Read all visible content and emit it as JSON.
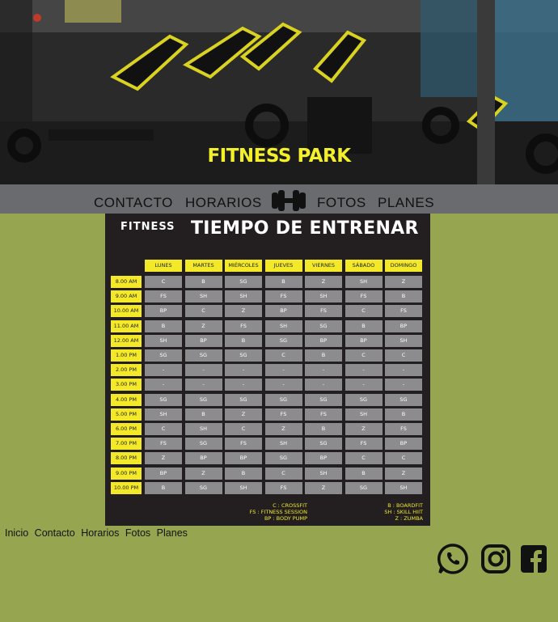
{
  "hero": {
    "title": "FITNESS PARK"
  },
  "nav": {
    "items": [
      "CONTACTO",
      "HORARIOS",
      "FOTOS",
      "PLANES"
    ]
  },
  "schedule": {
    "brand": "FITNESS",
    "title": "TIEMPO DE ENTRENAR",
    "days": [
      "LUNES",
      "MARTES",
      "MIÉRCOLES",
      "JUEVES",
      "VIERNES",
      "SÁBADO",
      "DOMINGO"
    ],
    "rows": [
      {
        "time": "8.00 AM",
        "classes": [
          "C",
          "B",
          "SG",
          "B",
          "Z",
          "SH",
          "Z"
        ]
      },
      {
        "time": "9.00 AM",
        "classes": [
          "FS",
          "SH",
          "SH",
          "FS",
          "SH",
          "FS",
          "B"
        ]
      },
      {
        "time": "10.00 AM",
        "classes": [
          "BP",
          "C",
          "Z",
          "BP",
          "FS",
          "C",
          "FS"
        ]
      },
      {
        "time": "11.00 AM",
        "classes": [
          "B",
          "Z",
          "FS",
          "SH",
          "SG",
          "B",
          "BP"
        ]
      },
      {
        "time": "12.00 AM",
        "classes": [
          "SH",
          "BP",
          "B",
          "SG",
          "BP",
          "BP",
          "SH"
        ]
      },
      {
        "time": "1.00 PM",
        "classes": [
          "SG",
          "SG",
          "SG",
          "C",
          "B",
          "C",
          "C"
        ]
      },
      {
        "time": "2.00 PM",
        "classes": [
          "-",
          "-",
          "-",
          "-",
          "-",
          "-",
          "-"
        ]
      },
      {
        "time": "3.00 PM",
        "classes": [
          "-",
          "-",
          "-",
          "-",
          "-",
          "-",
          "-"
        ]
      },
      {
        "time": "4.00 PM",
        "classes": [
          "SG",
          "SG",
          "SG",
          "SG",
          "SG",
          "SG",
          "SG"
        ]
      },
      {
        "time": "5.00 PM",
        "classes": [
          "SH",
          "B",
          "Z",
          "FS",
          "FS",
          "SH",
          "B"
        ]
      },
      {
        "time": "6.00 PM",
        "classes": [
          "C",
          "SH",
          "C",
          "Z",
          "B",
          "Z",
          "FS"
        ]
      },
      {
        "time": "7.00 PM",
        "classes": [
          "FS",
          "SG",
          "FS",
          "SH",
          "SG",
          "FS",
          "BP"
        ]
      },
      {
        "time": "8.00 PM",
        "classes": [
          "Z",
          "BP",
          "BP",
          "SG",
          "BP",
          "C",
          "C"
        ]
      },
      {
        "time": "9.00 PM",
        "classes": [
          "BP",
          "Z",
          "B",
          "C",
          "SH",
          "B",
          "Z"
        ]
      },
      {
        "time": "10.00 PM",
        "classes": [
          "B",
          "SG",
          "SH",
          "FS",
          "Z",
          "SG",
          "SH"
        ]
      }
    ],
    "legend_left": [
      "C : CROSSFIT",
      "FS : FITNESS SESSION",
      "BP : BODY PUMP"
    ],
    "legend_right": [
      "B : BOARDFIT",
      "SH : SKILL HIIT",
      "Z : ZUMBA"
    ]
  },
  "footer": {
    "links": [
      "Inicio",
      "Contacto",
      "Horarios",
      "Fotos",
      "Planes"
    ],
    "social": [
      "whatsapp-icon",
      "instagram-icon",
      "facebook-icon"
    ]
  },
  "colors": {
    "page_bg": "#96a650",
    "nav_bg": "#6a6b6e",
    "accent_yellow": "#f3e928",
    "board_bg": "#231f20",
    "cell_gray": "#8c8c8e"
  }
}
